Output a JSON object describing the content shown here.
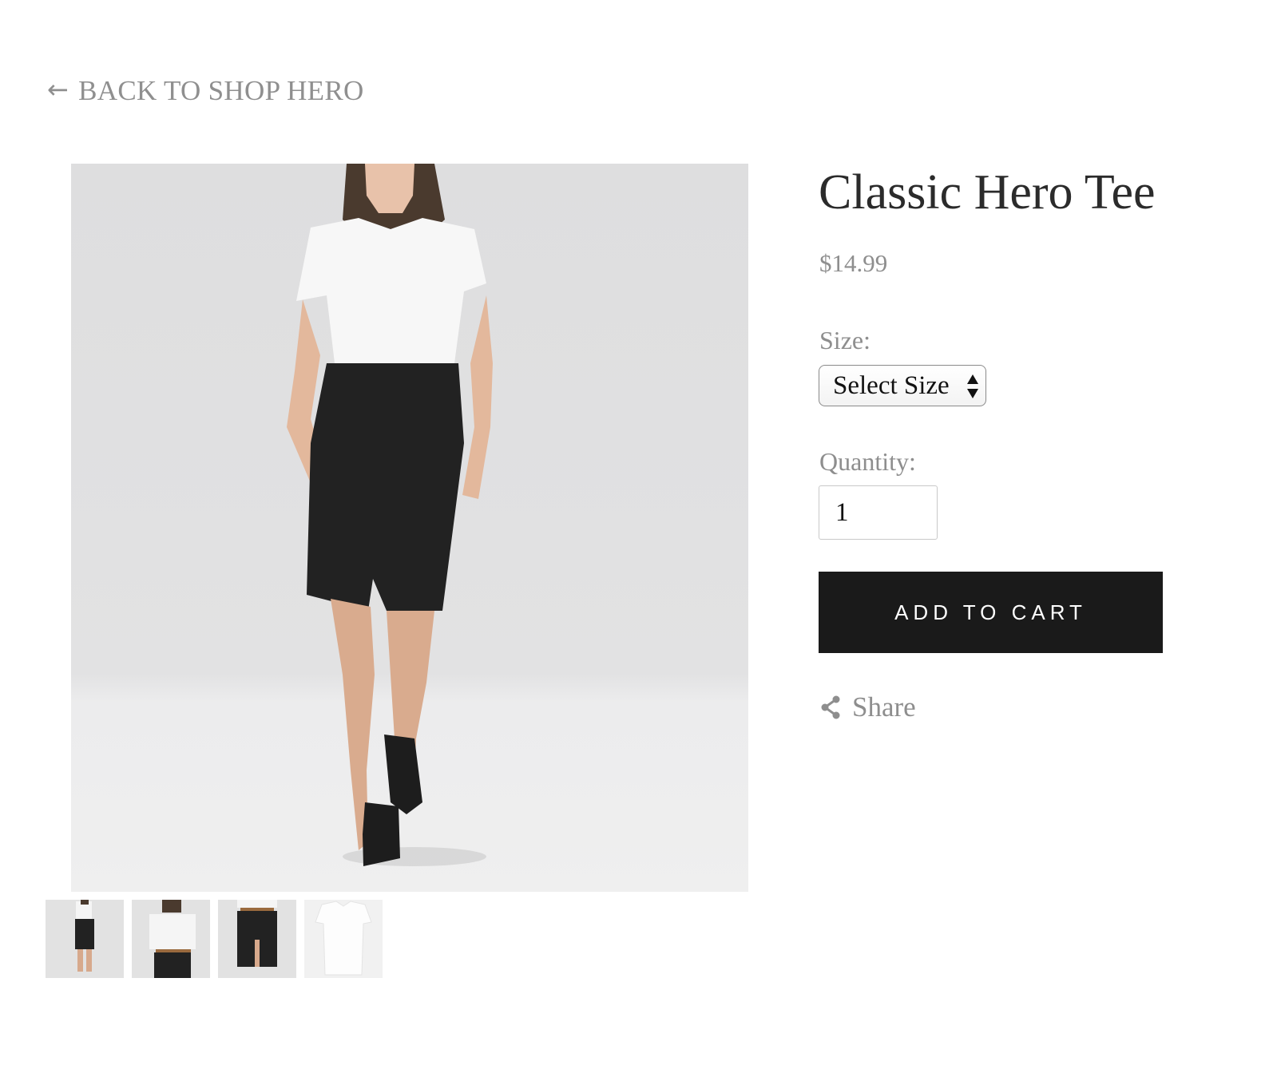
{
  "nav": {
    "back_arrow": "←",
    "back_label": "BACK TO SHOP HERO"
  },
  "product": {
    "title": "Classic Hero Tee",
    "price": "$14.99",
    "size_label": "Size:",
    "size_selected": "Select Size",
    "quantity_label": "Quantity:",
    "quantity_value": "1",
    "add_to_cart_label": "ADD TO CART",
    "share_label": "Share"
  },
  "gallery": {
    "thumbnail_count": 4
  },
  "colors": {
    "button_bg": "#1a1a1a",
    "muted_text": "#8e8e8e",
    "image_bg": "#e0e0e0"
  }
}
